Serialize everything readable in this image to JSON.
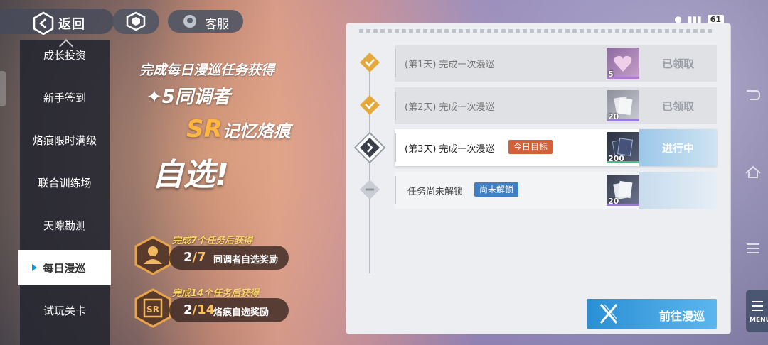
{
  "topbar": {
    "back_label": "返回",
    "service_label": "客服",
    "battery": "61"
  },
  "sidebar": {
    "items": [
      {
        "label": "成长投资",
        "active": false
      },
      {
        "label": "新手签到",
        "active": false
      },
      {
        "label": "烙痕限时满级",
        "active": false
      },
      {
        "label": "联合训练场",
        "active": false
      },
      {
        "label": "天隙勘测",
        "active": false
      },
      {
        "label": "每日漫巡",
        "active": true
      },
      {
        "label": "试玩关卡",
        "active": false
      }
    ]
  },
  "promo": {
    "line1": "完成每日漫巡任务获得",
    "line2": "✦5同调者",
    "line3_highlight": "SR",
    "line3": "记忆烙痕",
    "line4": "自选!"
  },
  "milestones": [
    {
      "caption": "完成7个任务后获得",
      "current": "2",
      "total": "/7",
      "name": "同调者自选奖励"
    },
    {
      "caption": "完成14个任务后获得",
      "current": "2",
      "total": "/14",
      "name": "烙痕自选奖励"
    }
  ],
  "tasks": [
    {
      "label": "(第1天) 完成一次漫巡",
      "reward_qty": "5",
      "status": "已领取",
      "state": "claimed"
    },
    {
      "label": "(第2天) 完成一次漫巡",
      "reward_qty": "20",
      "status": "已领取",
      "state": "claimed"
    },
    {
      "label": "(第3天) 完成一次漫巡",
      "tag": "今日目标",
      "reward_qty": "200",
      "status": "进行中",
      "state": "current"
    },
    {
      "label": "任务尚未解锁",
      "tag": "尚未解锁",
      "reward_qty": "20",
      "status": "",
      "state": "locked"
    }
  ],
  "go_button": {
    "label": "前往漫巡"
  },
  "menu": {
    "label": "MENU"
  },
  "colors": {
    "accent_blue": "#2a8fd4",
    "claimed_gold": "#e3a93a",
    "today_tag": "#d2613a",
    "locked_tag": "#3d7fc2"
  }
}
